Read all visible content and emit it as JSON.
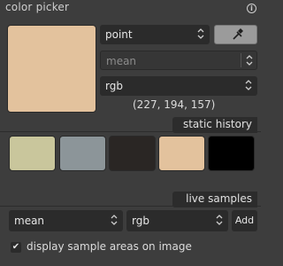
{
  "panel": {
    "title": "color picker",
    "info_icon": "info-icon"
  },
  "picker": {
    "swatch_color": "#e3c29d",
    "mode": "point",
    "statistic": "mean",
    "colorspace": "rgb",
    "value": "(227, 194, 157)",
    "picker_button_icon": "eyedropper-icon"
  },
  "static_history": {
    "label": "static history",
    "colors": [
      "#c9c69c",
      "#8c9599",
      "#2a2624",
      "#e3c29d",
      "#000000"
    ]
  },
  "live_samples": {
    "label": "live samples",
    "statistic": "mean",
    "colorspace": "rgb",
    "add_label": "Add"
  },
  "options": {
    "display_sample_areas_label": "display sample areas on image",
    "display_sample_areas_checked": true
  }
}
